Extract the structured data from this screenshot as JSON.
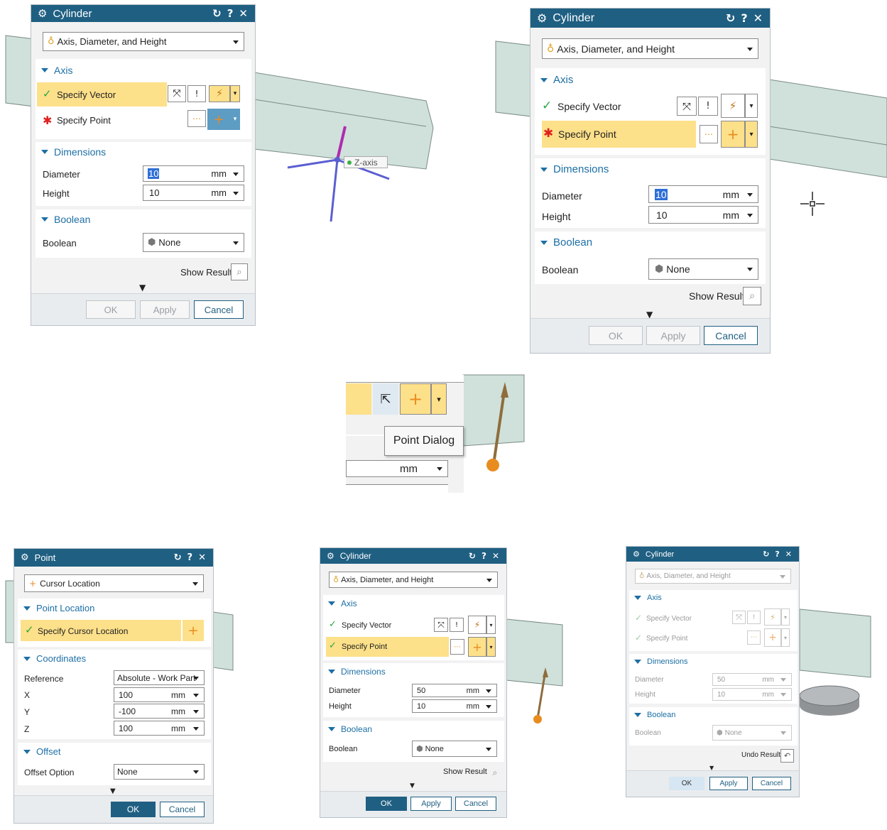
{
  "common": {
    "title_cylinder": "Cylinder",
    "title_point": "Point",
    "type_select": "Axis, Diameter, and Height",
    "axis_section": "Axis",
    "specify_vector": "Specify Vector",
    "specify_point": "Specify Point",
    "dimensions_section": "Dimensions",
    "diameter_label": "Diameter",
    "height_label": "Height",
    "unit": "mm",
    "boolean_section": "Boolean",
    "boolean_label": "Boolean",
    "boolean_value": "None",
    "show_result": "Show Result",
    "undo_result": "Undo Result",
    "ok": "OK",
    "apply": "Apply",
    "cancel": "Cancel"
  },
  "panel1": {
    "diameter": "10",
    "height": "10",
    "tooltip": "Z-axis"
  },
  "panel2": {
    "diameter": "10",
    "height": "10"
  },
  "panel3": {
    "tooltip": "Point Dialog",
    "unit": "mm"
  },
  "panel4": {
    "type_select": "Cursor Location",
    "point_location_section": "Point Location",
    "specify_cursor_location": "Specify Cursor Location",
    "coordinates_section": "Coordinates",
    "reference_label": "Reference",
    "reference_value": "Absolute - Work Part",
    "x_label": "X",
    "x_value": "100",
    "y_label": "Y",
    "y_value": "-100",
    "z_label": "Z",
    "z_value": "100",
    "offset_section": "Offset",
    "offset_option_label": "Offset Option",
    "offset_option_value": "None"
  },
  "panel5": {
    "diameter": "50",
    "height": "10"
  },
  "panel6": {
    "diameter": "50",
    "height": "10"
  },
  "colors": {
    "titlebar": "#1f5f82",
    "highlight": "#fde08a",
    "section_text": "#1d6fa5",
    "part": "#cfe1da",
    "check": "#2aa63f",
    "required": "#e02020"
  }
}
